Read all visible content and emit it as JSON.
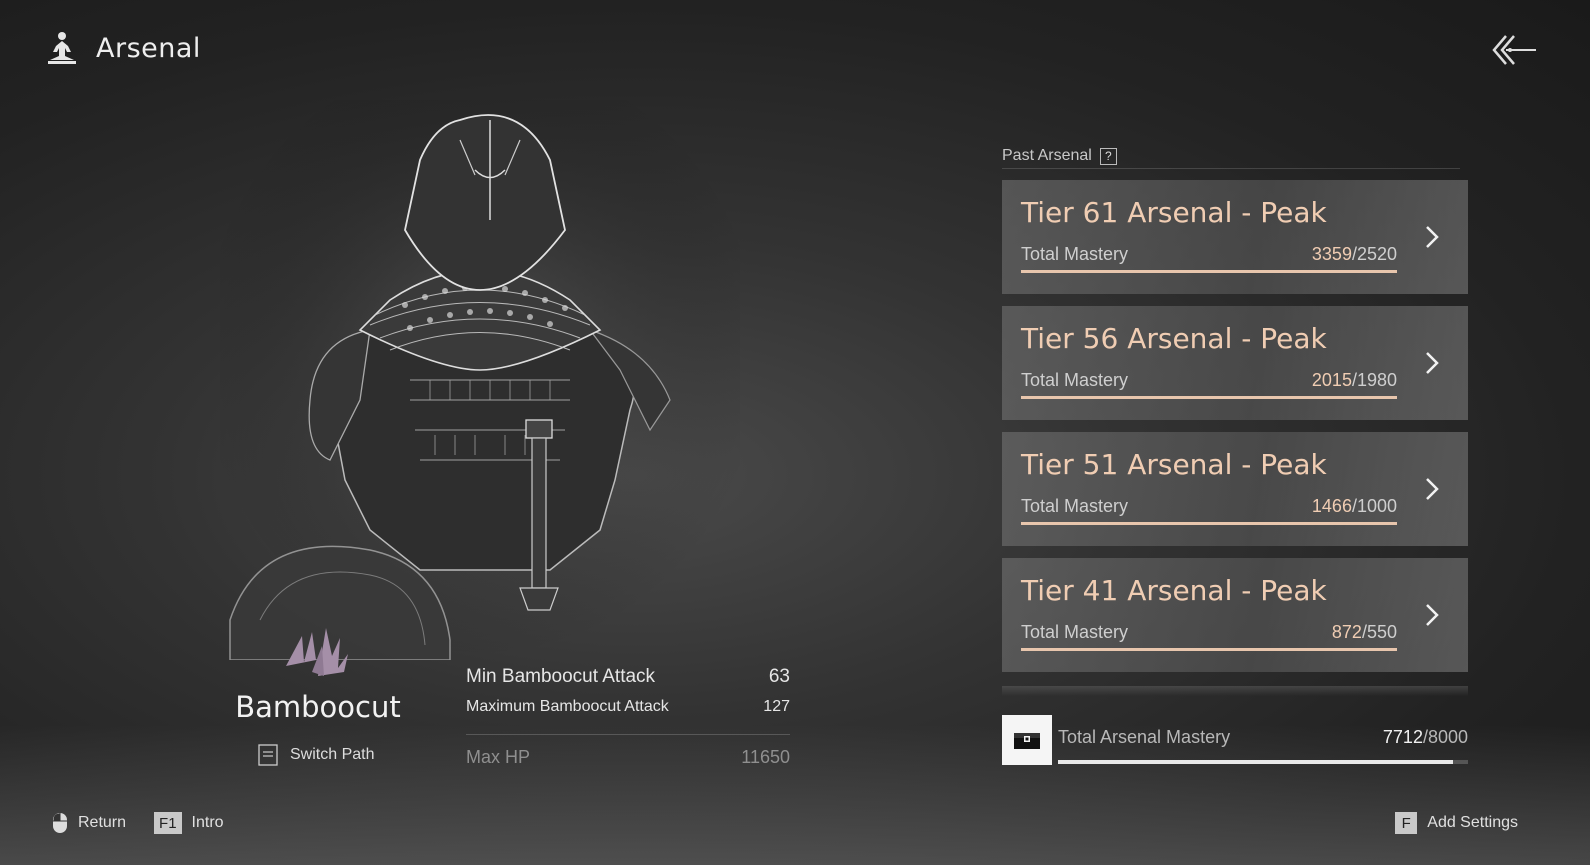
{
  "header": {
    "title": "Arsenal",
    "icon": "meditation-figure-icon"
  },
  "weapon": {
    "name": "Bamboocut",
    "switch_path_label": "Switch Path"
  },
  "stats": [
    {
      "label": "Min Bamboocut Attack",
      "value": "63"
    },
    {
      "label": "Maximum Bamboocut Attack",
      "value": "127"
    },
    {
      "label": "Max HP",
      "value": "11650"
    }
  ],
  "past_arsenal": {
    "label": "Past Arsenal",
    "help": "?",
    "tiers": [
      {
        "name": "Tier 61 Arsenal - Peak",
        "mastery_label": "Total Mastery",
        "current": "3359",
        "required": "/2520",
        "progress": 1.0
      },
      {
        "name": "Tier 56 Arsenal - Peak",
        "mastery_label": "Total Mastery",
        "current": "2015",
        "required": "/1980",
        "progress": 1.0
      },
      {
        "name": "Tier 51 Arsenal - Peak",
        "mastery_label": "Total Mastery",
        "current": "1466",
        "required": "/1000",
        "progress": 1.0
      },
      {
        "name": "Tier 41 Arsenal - Peak",
        "mastery_label": "Total Mastery",
        "current": "872",
        "required": "/550",
        "progress": 1.0
      }
    ]
  },
  "total": {
    "label": "Total Arsenal Mastery",
    "current": "7712",
    "required": "/8000",
    "progress": 0.964,
    "icon": "chest-icon"
  },
  "footer": {
    "return_label": "Return",
    "intro_key": "F1",
    "intro_label": "Intro",
    "settings_key": "F",
    "settings_label": "Add Settings"
  },
  "colors": {
    "accent": "#f0cdb3",
    "emblem": "#a58fa8"
  }
}
